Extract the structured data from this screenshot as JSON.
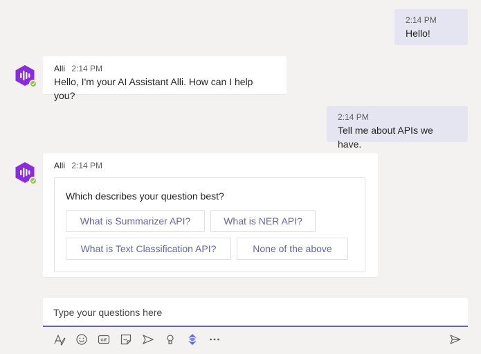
{
  "messages": [
    {
      "type": "out",
      "time": "2:14 PM",
      "text": "Hello!"
    },
    {
      "type": "in",
      "sender": "Alli",
      "time": "2:14 PM",
      "text": "Hello, I'm your AI Assistant Alli. How can I help you?"
    },
    {
      "type": "out",
      "time": "2:14 PM",
      "text": "Tell me about APIs we have."
    },
    {
      "type": "in",
      "sender": "Alli",
      "time": "2:14 PM",
      "card": {
        "question": "Which describes your question best?",
        "choices": [
          "What is Summarizer API?",
          "What is NER API?",
          "What is Text Classification API?",
          "None of the above"
        ]
      }
    }
  ],
  "composer": {
    "placeholder": "Type your questions here"
  },
  "toolbar": [
    "format-icon",
    "emoji-icon",
    "gif-icon",
    "sticker-icon",
    "meet-icon",
    "praise-icon",
    "app-icon",
    "more-icon"
  ],
  "colors": {
    "accent": "#6264a7",
    "avatar": "#8a2be2",
    "presence": "#92c353",
    "out_bubble": "#e5e5f1"
  }
}
